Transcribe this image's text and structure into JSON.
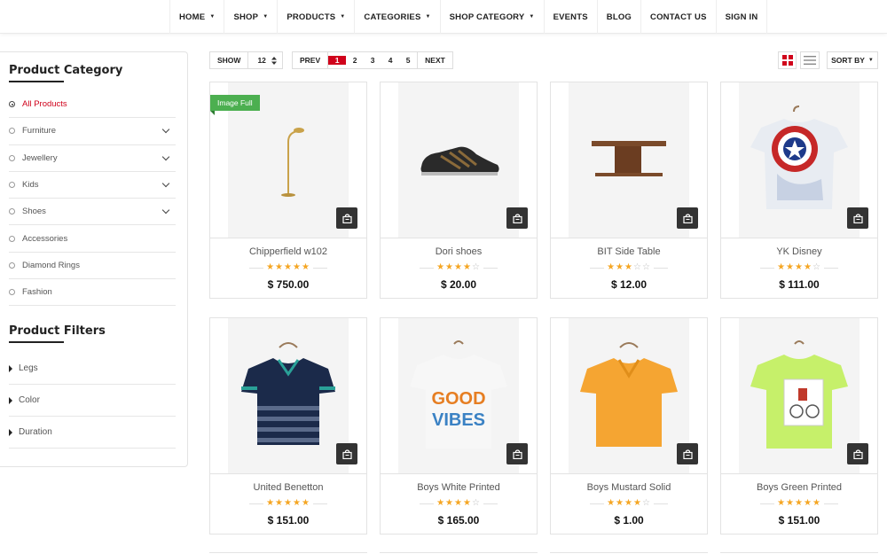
{
  "nav": {
    "items": [
      {
        "label": "HOME",
        "dropdown": true
      },
      {
        "label": "SHOP",
        "dropdown": true
      },
      {
        "label": "PRODUCTS",
        "dropdown": true
      },
      {
        "label": "CATEGORIES",
        "dropdown": true
      },
      {
        "label": "SHOP CATEGORY",
        "dropdown": true
      },
      {
        "label": "EVENTS",
        "dropdown": false
      },
      {
        "label": "BLOG",
        "dropdown": false
      },
      {
        "label": "CONTACT US",
        "dropdown": false
      },
      {
        "label": "SIGN IN",
        "dropdown": false
      }
    ]
  },
  "sidebar": {
    "category_title": "Product Category",
    "categories": [
      {
        "label": "All Products",
        "active": true,
        "expandable": false
      },
      {
        "label": "Furniture",
        "active": false,
        "expandable": true
      },
      {
        "label": "Jewellery",
        "active": false,
        "expandable": true
      },
      {
        "label": "Kids",
        "active": false,
        "expandable": true
      },
      {
        "label": "Shoes",
        "active": false,
        "expandable": true
      },
      {
        "label": "Accessories",
        "active": false,
        "expandable": false
      },
      {
        "label": "Diamond Rings",
        "active": false,
        "expandable": false
      },
      {
        "label": "Fashion",
        "active": false,
        "expandable": false
      }
    ],
    "filters_title": "Product Filters",
    "filters": [
      {
        "label": "Legs"
      },
      {
        "label": "Color"
      },
      {
        "label": "Duration"
      }
    ]
  },
  "toolbar": {
    "show_label": "SHOW",
    "show_value": "12",
    "prev_label": "PREV",
    "pages": [
      "1",
      "2",
      "3",
      "4",
      "5"
    ],
    "current_page": "1",
    "next_label": "NEXT",
    "sort_label": "SORT BY"
  },
  "products": [
    {
      "name": "Chipperfield w102",
      "price": "$ 750.00",
      "rating": 5,
      "badge": "Image Full",
      "image": "floor-lamp"
    },
    {
      "name": "Dori shoes",
      "price": "$ 20.00",
      "rating": 4,
      "badge": "",
      "image": "sneaker"
    },
    {
      "name": "BIT Side Table",
      "price": "$ 12.00",
      "rating": 3,
      "badge": "",
      "image": "side-table"
    },
    {
      "name": "YK Disney",
      "price": "$ 111.00",
      "rating": 4,
      "badge": "",
      "image": "shield-tshirt"
    },
    {
      "name": "United Benetton",
      "price": "$ 151.00",
      "rating": 5,
      "badge": "",
      "image": "striped-polo"
    },
    {
      "name": "Boys White Printed",
      "price": "$ 165.00",
      "rating": 4,
      "badge": "",
      "image": "good-vibes-tshirt"
    },
    {
      "name": "Boys Mustard Solid",
      "price": "$ 1.00",
      "rating": 4,
      "badge": "",
      "image": "mustard-polo"
    },
    {
      "name": "Boys Green Printed",
      "price": "$ 151.00",
      "rating": 5,
      "badge": "",
      "image": "green-tshirt"
    }
  ],
  "colors": {
    "accent": "#d0021b",
    "star": "#f5a623",
    "badge": "#4caf50",
    "cart_button": "#333333"
  }
}
